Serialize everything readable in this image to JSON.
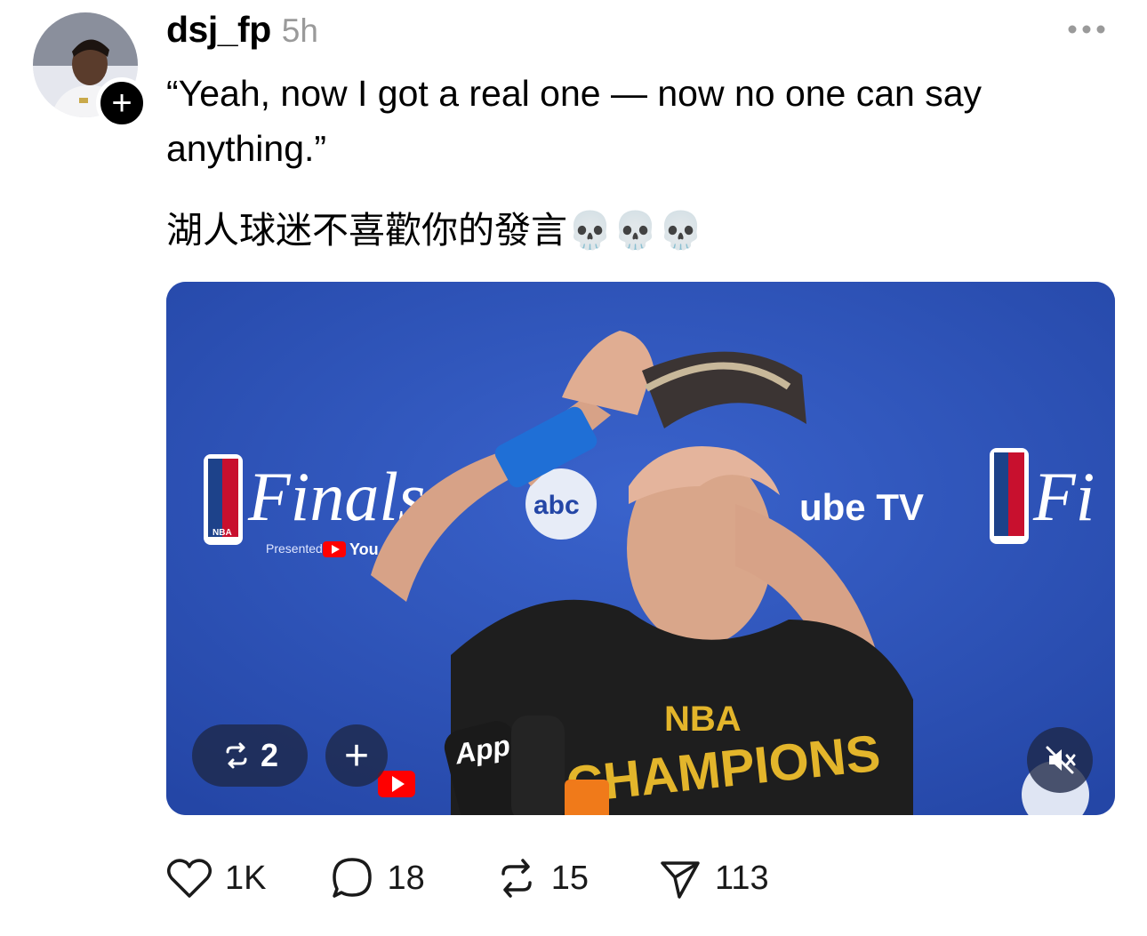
{
  "post": {
    "username": "dsj_fp",
    "time": "5h",
    "text_line1": "“Yeah, now I got a real one — now no one can say anything.”",
    "text_line2": "湖人球迷不喜歡你的發言💀💀💀",
    "follow_icon": "plus-icon",
    "more_icon": "ellipsis-icon"
  },
  "media": {
    "overlay": {
      "repost_count": "2",
      "add_icon": "plus-icon",
      "mute_icon": "speaker-muted-icon"
    },
    "scene_text": {
      "finals_left": "Finals",
      "finals_right": "Fi",
      "presented_left": "Presented by",
      "youtube_left": "You",
      "tube_tv": "ube TV",
      "abc": "abc",
      "nba_badge": "NBA",
      "app_label": "App",
      "shirt_nba": "NBA",
      "shirt_champions": "CHAMPIONS"
    }
  },
  "actions": {
    "likes": "1K",
    "comments": "18",
    "reposts": "15",
    "shares": "113"
  },
  "colors": {
    "backdrop": "#2b4fb4",
    "overlay": "#1e2846",
    "muted_text": "#9a9a9a"
  }
}
